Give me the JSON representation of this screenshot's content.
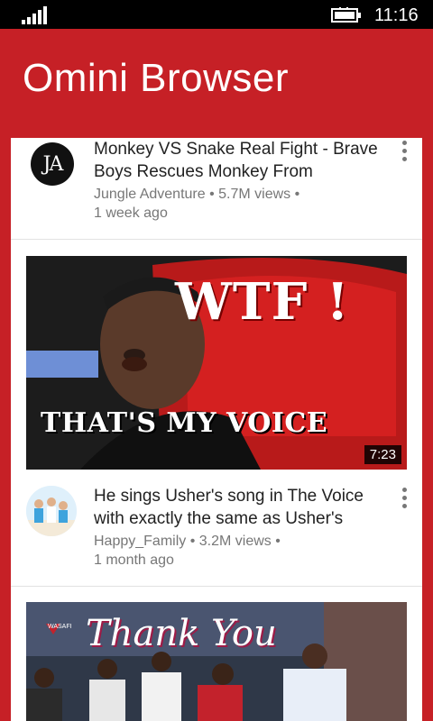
{
  "status_bar": {
    "time": "11:16",
    "signal_icon": "signal-icon",
    "battery_icon": "battery-charging-icon"
  },
  "app": {
    "title": "Omini Browser",
    "accent_color": "#c62026"
  },
  "videos": [
    {
      "title": "Monkey VS Snake Real Fight - Brave Boys Rescues Monkey From",
      "channel_line": "Jungle Adventure • 5.7M views •",
      "age": "1 week ago",
      "avatar_text": "JA"
    },
    {
      "thumbnail_text_top": "WTF !",
      "thumbnail_text_bottom": "THAT'S MY VOICE",
      "duration": "7:23",
      "title": "He sings Usher's song in The Voice with exactly the same as Usher's",
      "channel_line": "Happy_Family • 3.2M views •",
      "age": "1 month ago"
    },
    {
      "thumbnail_text": "Thank You",
      "thumbnail_small_text": "WASAFI"
    }
  ]
}
